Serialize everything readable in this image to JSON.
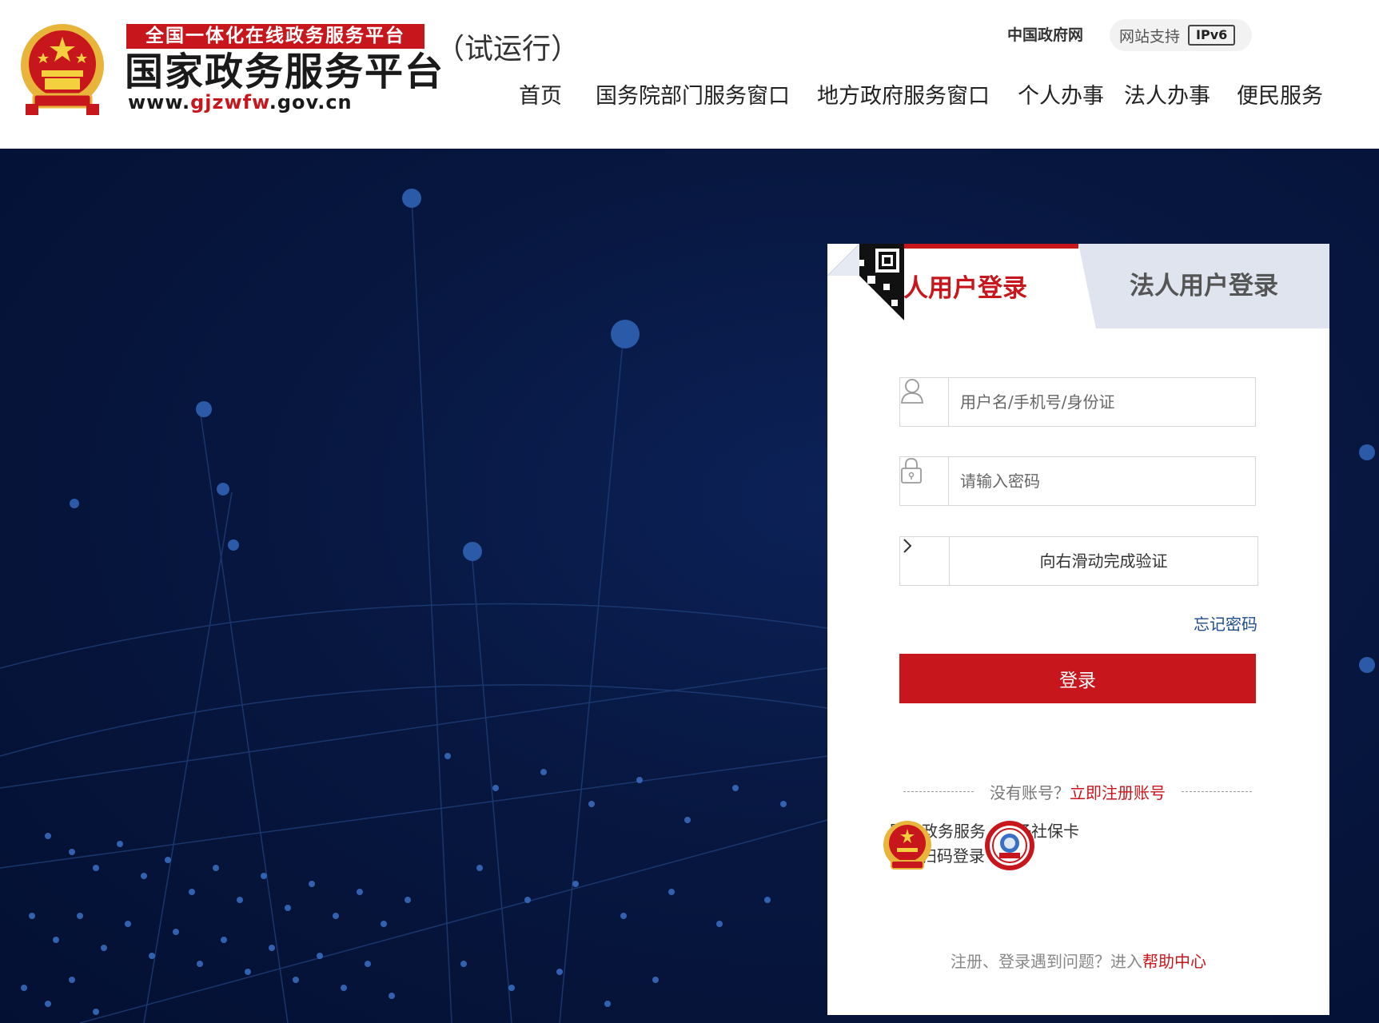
{
  "header": {
    "banner": "全国一体化在线政务服务平台",
    "title": "国家政务服务平台",
    "url_prefix": "www.",
    "url_highlight": "gjzwfw",
    "url_suffix": ".gov.cn",
    "trial": "（试运行）",
    "gov_link": "中国政府网",
    "ipv6_label": "网站支持",
    "ipv6_badge": "IPv6"
  },
  "nav": [
    {
      "label": "首页"
    },
    {
      "label": "国务院部门服务窗口"
    },
    {
      "label": "地方政府服务窗口"
    },
    {
      "label": "个人办事"
    },
    {
      "label": "法人办事"
    },
    {
      "label": "便民服务"
    }
  ],
  "login": {
    "tab_personal": "个人用户登录",
    "tab_legal": "法人用户登录",
    "username_placeholder": "用户名/手机号/身份证",
    "password_placeholder": "请输入密码",
    "slider_text": "向右滑动完成验证",
    "forgot": "忘记密码",
    "submit": "登录",
    "no_account": "没有账号？",
    "register": "立即注册账号",
    "alt_app_line1": "国家政务服务",
    "alt_app_line2": "APP扫码登录",
    "alt_social": "电子社保卡",
    "help_prefix": "注册、登录遇到问题？进入",
    "help_link": "帮助中心"
  },
  "colors": {
    "brand_red": "#c8161d",
    "link_blue": "#1d4c8c",
    "background_navy": "#071740"
  },
  "icons": [
    "national-emblem-icon",
    "user-icon",
    "lock-icon",
    "chevron-right-icon",
    "qr-code-icon",
    "social-security-card-icon"
  ]
}
